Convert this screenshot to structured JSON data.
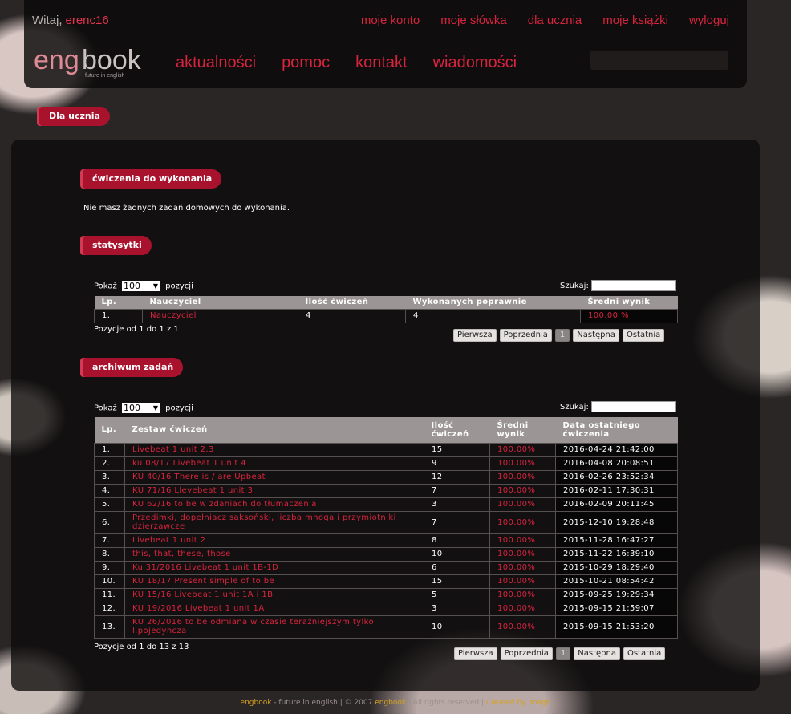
{
  "header": {
    "welcome_prefix": "Witaj,",
    "username": "erenc16",
    "top_links": [
      "moje konto",
      "moje słówka",
      "dla ucznia",
      "moje książki",
      "wyloguj"
    ],
    "logo_main": "engbook",
    "logo_tagline": "future in english",
    "main_links": [
      "aktualności",
      "pomoc",
      "kontakt",
      "wiadomości"
    ]
  },
  "breadcrumb": "Dla ucznia",
  "sections": {
    "exercises": {
      "title": "ćwiczenia do wykonania",
      "message": "Nie masz żadnych zadań domowych do wykonania."
    },
    "stats": {
      "title": "statysytki",
      "show_prefix": "Pokaż",
      "show_value": "100",
      "show_suffix": "pozycji",
      "search_label": "Szukaj:",
      "columns": [
        "Lp.",
        "Nauczyciel",
        "Ilość ćwiczeń",
        "Wykonanych poprawnie",
        "Średni wynik"
      ],
      "rows": [
        {
          "lp": "1.",
          "teacher": "Nauczyciel",
          "count": "4",
          "correct": "4",
          "avg": "100.00 %"
        }
      ],
      "info": "Pozycje od 1 do 1 z 1",
      "pager": [
        "Pierwsza",
        "Poprzednia",
        "1",
        "Następna",
        "Ostatnia"
      ]
    },
    "archive": {
      "title": "archiwum zadań",
      "show_prefix": "Pokaż",
      "show_value": "100",
      "show_suffix": "pozycji",
      "search_label": "Szukaj:",
      "columns": [
        "Lp.",
        "Zestaw ćwiczeń",
        "Ilość ćwiczeń",
        "Średni wynik",
        "Data ostatniego ćwiczenia"
      ],
      "rows": [
        {
          "lp": "1.",
          "set": "Livebeat 1 unit 2,3",
          "count": "15",
          "avg": "100.00%",
          "date": "2016-04-24 21:42:00"
        },
        {
          "lp": "2.",
          "set": "ku 08/17 Livebeat 1 unit 4",
          "count": "9",
          "avg": "100.00%",
          "date": "2016-04-08 20:08:51"
        },
        {
          "lp": "3.",
          "set": "KU 40/16 There is / are Upbeat",
          "count": "12",
          "avg": "100.00%",
          "date": "2016-02-26 23:52:34"
        },
        {
          "lp": "4.",
          "set": "KU 71/16 Llevebeat 1 unit 3",
          "count": "7",
          "avg": "100.00%",
          "date": "2016-02-11 17:30:31"
        },
        {
          "lp": "5.",
          "set": "KU 62/16 to be w zdaniach do tłumaczenia",
          "count": "3",
          "avg": "100.00%",
          "date": "2016-02-09 20:11:45"
        },
        {
          "lp": "6.",
          "set": "Przedimki, dopełniacz saksoński, liczba mnoga i przymiotniki dzierżawcze",
          "count": "7",
          "avg": "100.00%",
          "date": "2015-12-10 19:28:48"
        },
        {
          "lp": "7.",
          "set": "Livebeat 1 unit 2",
          "count": "8",
          "avg": "100.00%",
          "date": "2015-11-28 16:47:27"
        },
        {
          "lp": "8.",
          "set": "this, that, these, those",
          "count": "10",
          "avg": "100.00%",
          "date": "2015-11-22 16:39:10"
        },
        {
          "lp": "9.",
          "set": "Ku 31/2016 Livebeat 1 unit 1B-1D",
          "count": "6",
          "avg": "100.00%",
          "date": "2015-10-29 18:29:40"
        },
        {
          "lp": "10.",
          "set": "KU 18/17 Present simple of to be",
          "count": "15",
          "avg": "100.00%",
          "date": "2015-10-21 08:54:42"
        },
        {
          "lp": "11.",
          "set": "KU 15/16 Livebeat 1 unit 1A i 1B",
          "count": "5",
          "avg": "100.00%",
          "date": "2015-09-25 19:29:34"
        },
        {
          "lp": "12.",
          "set": "KU 19/2016 Livebeat 1 unit 1A",
          "count": "3",
          "avg": "100.00%",
          "date": "2015-09-15 21:59:07"
        },
        {
          "lp": "13.",
          "set": "KU 26/2016 to be odmiana w czasie teraźniejszym tylko l.pojedyncza",
          "count": "10",
          "avg": "100.00%",
          "date": "2015-09-15 21:53:20"
        }
      ],
      "info": "Pozycje od 1 do 13 z 13",
      "pager": [
        "Pierwsza",
        "Poprzednia",
        "1",
        "Następna",
        "Ostatnia"
      ]
    }
  },
  "footer": {
    "brand": "engbook",
    "text": " - future in english | © 2007 ",
    "brand2": "engbook",
    "rights": " | All rights reserved | ",
    "credit": "Created by Imago"
  },
  "colors": {
    "accent": "#d8243e",
    "tag_bg": "#a8122d",
    "header_row": "#9b9595"
  }
}
